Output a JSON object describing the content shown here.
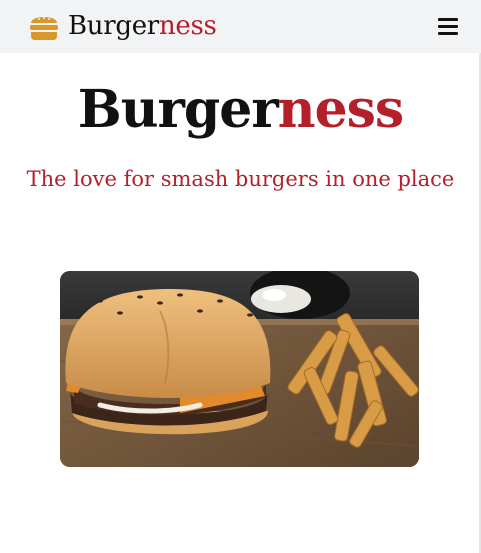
{
  "nav": {
    "brand_main": "Burger",
    "brand_accent": "ness",
    "brand_icon": "hamburger-icon",
    "menu_icon": "menu-icon"
  },
  "hero": {
    "title_main": "Burger",
    "title_accent": "ness",
    "tagline": "The love for smash burgers in one place"
  },
  "colors": {
    "accent": "#b3202a",
    "nav_background": "#f2f3f5",
    "icon": "#d9982b"
  },
  "image": {
    "subject": "smash burger with fries and dip on a wooden board"
  }
}
